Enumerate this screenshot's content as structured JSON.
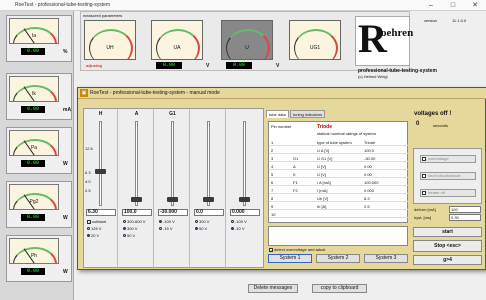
{
  "main_window": {
    "title": "RoeTest - professional-tube-testing-system",
    "version_label": "version",
    "version_value": "11.1.0.0",
    "measured_header": "measured parameters",
    "adjusting_label": "adjusting",
    "brand": "professional-tube-testing-system",
    "copyright": "(c) Helmut Weigl",
    "logo_text": "oehren",
    "logo_letter": "R",
    "bottom_buttons": [
      "Delete messages",
      "copy to clipboard"
    ]
  },
  "left_meters": [
    {
      "name": "Ia",
      "value": "0.00",
      "unit": "%"
    },
    {
      "name": "Ik",
      "value": "0.00",
      "unit": "mA"
    },
    {
      "name": "Pa",
      "value": "0.00",
      "unit": "W"
    },
    {
      "name": "Pg2",
      "value": "0.00",
      "unit": "W"
    },
    {
      "name": "Ph",
      "value": "0.00",
      "unit": "W"
    }
  ],
  "top_meters": [
    {
      "name": "UH",
      "value": "0.00",
      "unit": "V"
    },
    {
      "name": "UA",
      "value": "0.00",
      "unit": "V"
    },
    {
      "name": "U",
      "value": "0.00",
      "unit": "V"
    },
    {
      "name": "UG1",
      "value": "0.00",
      "unit": "V"
    }
  ],
  "modal": {
    "title": "RoeTest - professional-tube-testing-system - manual mode",
    "sliders": [
      {
        "head": "H",
        "value": "6.30",
        "opt1": "softstart",
        "opt2": "125 V",
        "opt3": "20 V"
      },
      {
        "head": "A",
        "value": "100.0",
        "opt1": "300-600 V",
        "opt2": "300 V",
        "opt3": "50 V"
      },
      {
        "head": "G1",
        "value": "-30.000",
        "opt1": "-100 V",
        "opt2": "-15 V",
        "opt3": ""
      },
      {
        "head": "",
        "value": "0.0",
        "opt1": "300 V",
        "opt2": "50 V",
        "opt3": ""
      },
      {
        "head": "",
        "value": "0.000",
        "opt1": "-100 V",
        "opt2": "-10 V",
        "opt3": ""
      }
    ],
    "h_scale": [
      "12.6",
      "6.3",
      "4.0",
      "2.5"
    ],
    "tabs": [
      "tube data",
      "tuning indicators"
    ],
    "grid": {
      "header": "Triode",
      "subheader": "statical nominal ratings of system",
      "col_pin": "Pin number",
      "rows": [
        {
          "pin": "1",
          "key": "type of tube system",
          "val": "Triode"
        },
        {
          "pin": "2",
          "key": "U A [V]",
          "val": "100.0"
        },
        {
          "pin": "3",
          "key": "U G1 [V]",
          "val": "-30.00"
        },
        {
          "pin": "4",
          "key": "U [V]",
          "val": "0.00"
        },
        {
          "pin": "5",
          "key": "U [V]",
          "val": "0.00"
        },
        {
          "pin": "6",
          "key": "I A [mA]",
          "val": "100.000"
        },
        {
          "pin": "7",
          "key": "I [mA]",
          "val": "0.000"
        },
        {
          "pin": "8",
          "key": "Uh [V]",
          "val": "6.3"
        },
        {
          "pin": "9",
          "key": "Ih [A]",
          "val": "2.5"
        },
        {
          "pin": "10",
          "key": "",
          "val": ""
        }
      ],
      "pin_labels": [
        "",
        "",
        "G1",
        "A",
        "K",
        "F1",
        "F2",
        "",
        "",
        ""
      ]
    },
    "detect_label": "detect overvoltage and adust",
    "system_buttons": [
      "System 1",
      "System 2",
      "System 3"
    ],
    "right": {
      "voltages_off": "voltages off !",
      "seconds_value": "0",
      "seconds_label": "seconds",
      "side_buttons": [
        "overvoltage",
        "short circuit/anode",
        "heater off"
      ],
      "deform_label": "deform [mA]",
      "deform_value": "100",
      "hyst_label": "hyst. [ms]",
      "hyst_value": "0.30",
      "start": "start",
      "stop": "Stop <esc>",
      "g4": "g>4"
    }
  }
}
